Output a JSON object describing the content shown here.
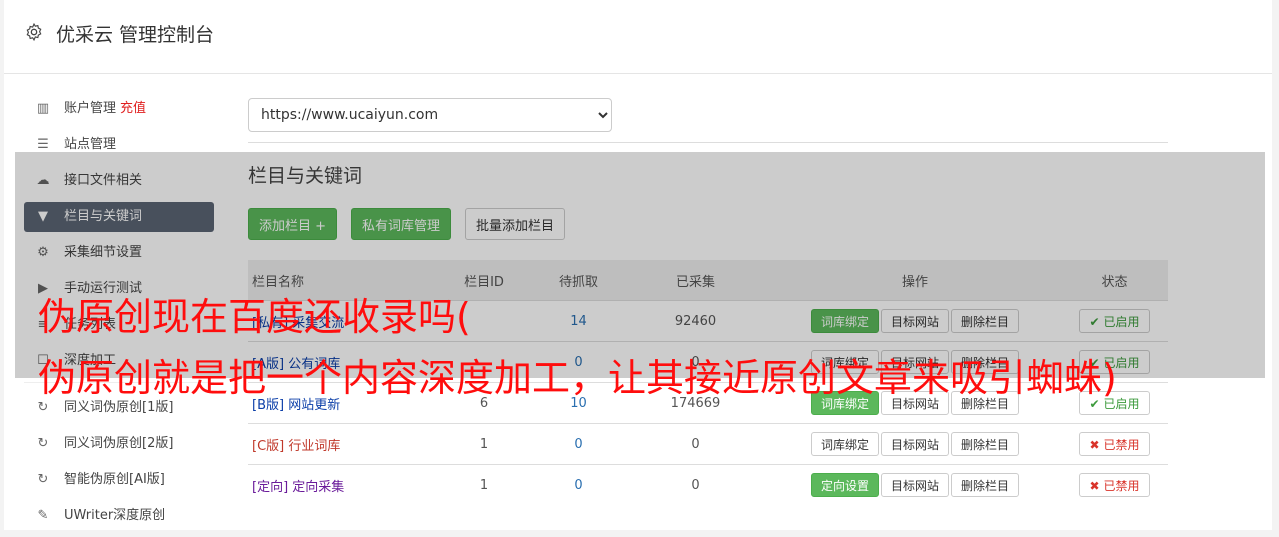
{
  "header": {
    "title": "优采云 管理控制台",
    "icon": "gear-icon"
  },
  "sidebar": {
    "items": [
      {
        "icon": "bar-chart-icon",
        "label": "账户管理",
        "extra": "充值"
      },
      {
        "icon": "server-icon",
        "label": "站点管理"
      },
      {
        "icon": "cloud-upload-icon",
        "label": "接口文件相关"
      },
      {
        "icon": "filter-icon",
        "label": "栏目与关键词",
        "active": true
      },
      {
        "icon": "cogs-icon",
        "label": "采集细节设置"
      },
      {
        "icon": "play-icon",
        "label": "手动运行测试"
      },
      {
        "icon": "list-icon",
        "label": "任务列表"
      },
      {
        "icon": "checkbox-icon",
        "label": "深度加工"
      },
      {
        "icon": "refresh-icon",
        "label": "同义词伪原创[1版]"
      },
      {
        "icon": "refresh-icon",
        "label": "同义词伪原创[2版]"
      },
      {
        "icon": "refresh-icon",
        "label": "智能伪原创[AI版]"
      },
      {
        "icon": "edit-icon",
        "label": "UWriter深度原创"
      }
    ]
  },
  "site_select": {
    "value": "https://www.ucaiyun.com"
  },
  "section_title": "栏目与关键词",
  "buttons": {
    "add_column": "添加栏目 +",
    "private_lib": "私有词库管理",
    "batch_add": "批量添加栏目"
  },
  "table": {
    "headers": [
      "栏目名称",
      "栏目ID",
      "待抓取",
      "已采集",
      "操作",
      "状态"
    ],
    "rows": [
      {
        "tag": "[私有]",
        "name": "采集交流",
        "id": "",
        "pending": "14",
        "collected": "92460",
        "bind_label": "词库绑定",
        "bind_green": true,
        "status": "已启用",
        "on": true
      },
      {
        "tag": "[A版]",
        "name": "公有词库",
        "id": "",
        "pending": "0",
        "collected": "0",
        "bind_label": "词库绑定",
        "bind_green": false,
        "status": "已启用",
        "on": true
      },
      {
        "tag": "[B版]",
        "name": "网站更新",
        "id": "6",
        "pending": "10",
        "collected": "174669",
        "bind_label": "词库绑定",
        "bind_green": true,
        "status": "已启用",
        "on": true
      },
      {
        "tag": "[C版]",
        "name": "行业词库",
        "id": "1",
        "pending": "0",
        "collected": "0",
        "bind_label": "词库绑定",
        "bind_green": false,
        "status": "已禁用",
        "on": false
      },
      {
        "tag": "[定向]",
        "name": "定向采集",
        "id": "1",
        "pending": "0",
        "collected": "0",
        "bind_label": "定向设置",
        "bind_green": true,
        "status": "已禁用",
        "on": false
      }
    ],
    "target_site": "目标网站",
    "delete_column": "删除栏目"
  },
  "overlay_text": {
    "line1": "伪原创现在百度还收录吗(",
    "line2": "伪原创就是把一个内容深度加工，让其接近原创文章来吸引蜘蛛)"
  },
  "colors": {
    "green": "#5cb85c",
    "active_nav": "#5b6573",
    "overlay_text": "#ff0d0d"
  }
}
